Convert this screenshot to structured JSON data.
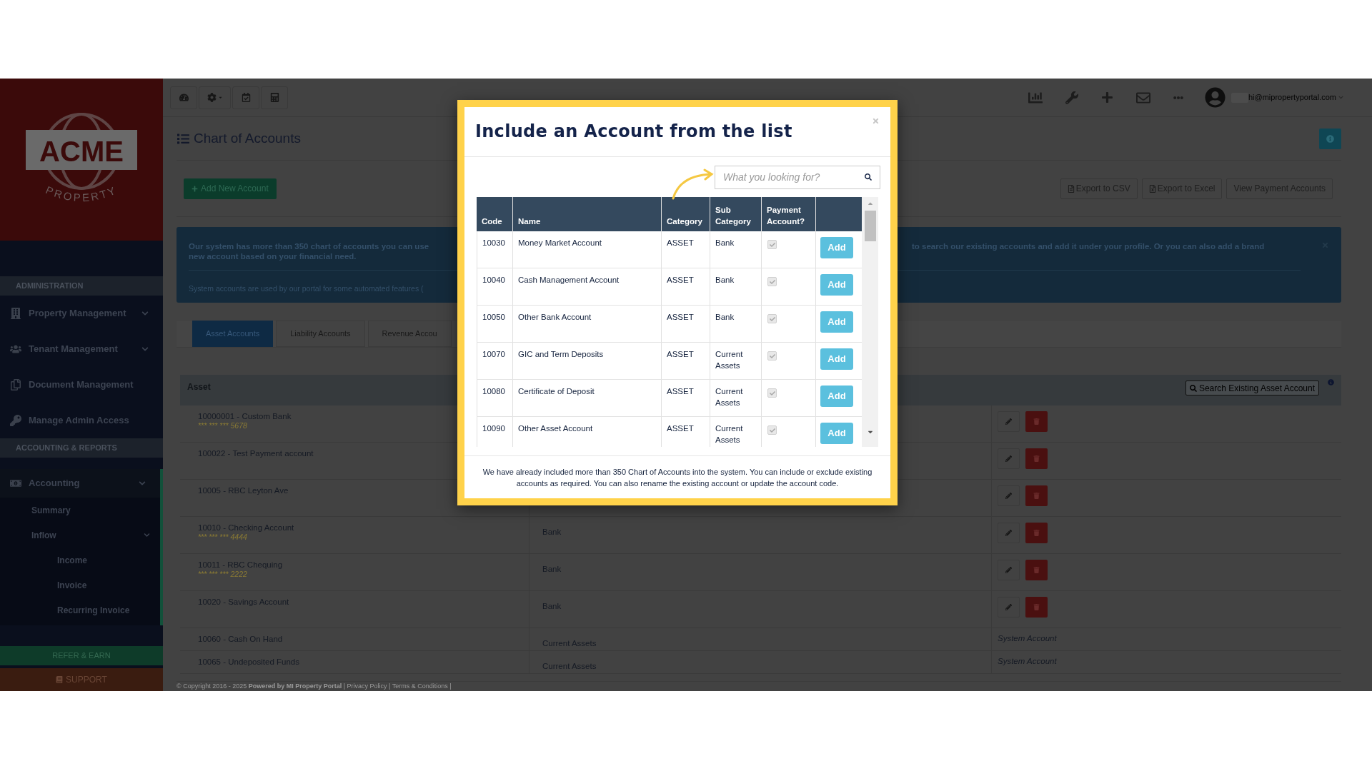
{
  "sidebar": {
    "logo": {
      "name": "ACME",
      "tagline": "PROPERTY"
    },
    "sections": [
      {
        "title": "ADMINISTRATION",
        "items": [
          {
            "label": "Property Management",
            "has_submenu": true,
            "selected": false
          },
          {
            "label": "Tenant Management",
            "has_submenu": true,
            "selected": false
          },
          {
            "label": "Document Management",
            "has_submenu": false,
            "selected": false
          },
          {
            "label": "Manage Admin Access",
            "has_submenu": false,
            "selected": false
          }
        ]
      },
      {
        "title": "ACCOUNTING & REPORTS",
        "items": [
          {
            "label": "Accounting",
            "has_submenu": true,
            "selected": true,
            "children": [
              {
                "label": "Summary",
                "has_submenu": false
              },
              {
                "label": "Inflow",
                "has_submenu": true,
                "children": [
                  {
                    "label": "Income"
                  },
                  {
                    "label": "Invoice"
                  },
                  {
                    "label": "Recurring Invoice"
                  }
                ]
              }
            ]
          }
        ]
      }
    ],
    "refer_button": "REFER & EARN",
    "support_button": "SUPPORT"
  },
  "top_bar": {
    "user_email": "hi@mipropertyportal.com"
  },
  "page": {
    "title": "Chart of Accounts",
    "add_button": "Add New Account",
    "actions": [
      {
        "label": "Export to CSV",
        "kind": "file"
      },
      {
        "label": "Export to Excel",
        "kind": "spreadsheet"
      },
      {
        "label": "View Payment Accounts",
        "kind": "plain"
      }
    ],
    "alert": {
      "left_lines": [
        "Our system has more than 350 chart of accounts you can use",
        "new account based on your financial need."
      ],
      "right_line": "to search our existing accounts and add it under your profile. Or you can also add a brand",
      "note": "System accounts are used by our portal for some automated features ("
    },
    "tabs": [
      {
        "label": "Asset Accounts",
        "selected": true
      },
      {
        "label": "Liability Accounts",
        "selected": false
      },
      {
        "label": "Revenue Accou",
        "selected": false
      }
    ],
    "accounts_table": {
      "heading": "Asset",
      "search_button": "Search Existing Asset Account",
      "rows": [
        {
          "kind": "custom",
          "name": "10000001 - Custom Bank",
          "masked_number": "*** *** *** 5678"
        },
        {
          "kind": "custom",
          "name": "100022 - Test Payment account"
        },
        {
          "kind": "custom",
          "name": "10005 - RBC Leyton Ave"
        },
        {
          "kind": "custom",
          "name": "10010 - Checking Account",
          "masked_number": "*** *** *** 4444",
          "sub_category": "Bank"
        },
        {
          "kind": "custom",
          "name": "10011 - RBC Chequing",
          "masked_number": "*** *** *** 2222",
          "sub_category": "Bank"
        },
        {
          "kind": "custom",
          "name": "10020 - Savings Account",
          "sub_category": "Bank"
        },
        {
          "kind": "system",
          "name": "10060 - Cash On Hand",
          "sub_category": "Current Assets",
          "system_label": "System Account"
        },
        {
          "kind": "system",
          "name": "10065 - Undeposited Funds",
          "sub_category": "Current Assets",
          "system_label": "System Account"
        }
      ]
    },
    "footer": "© Copyright 2016 - 2025 **Powered by MI Property Portal** | Privacy Policy | Terms & Conditions |"
  },
  "modal": {
    "title": "Include an Account from the list",
    "search_placeholder": "What you looking for?",
    "columns": [
      "Code",
      "Name",
      "Category",
      "Sub Category",
      "Payment Account?"
    ],
    "rows": [
      {
        "code": "10030",
        "name": "Money Market Account",
        "category": "ASSET",
        "sub_category": "Bank",
        "payment_account": true,
        "button": "Add"
      },
      {
        "code": "10040",
        "name": "Cash Management Account",
        "category": "ASSET",
        "sub_category": "Bank",
        "payment_account": true,
        "button": "Add"
      },
      {
        "code": "10050",
        "name": "Other Bank Account",
        "category": "ASSET",
        "sub_category": "Bank",
        "payment_account": true,
        "button": "Add"
      },
      {
        "code": "10070",
        "name": "GIC and Term Deposits",
        "category": "ASSET",
        "sub_category": "Current Assets",
        "payment_account": true,
        "button": "Add"
      },
      {
        "code": "10080",
        "name": "Certificate of Deposit",
        "category": "ASSET",
        "sub_category": "Current Assets",
        "payment_account": true,
        "button": "Add"
      },
      {
        "code": "10090",
        "name": "Other Asset Account",
        "category": "ASSET",
        "sub_category": "Current Assets",
        "payment_account": true,
        "button": "Add"
      }
    ],
    "note": "We have already included more than 350 Chart of Accounts into the system. You can include or exclude existing accounts as required. You can also rename the existing account or update the account code."
  }
}
